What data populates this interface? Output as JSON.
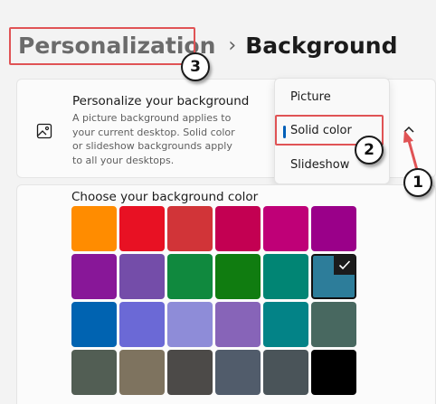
{
  "breadcrumb": {
    "parent": "Personalization",
    "separator": "›",
    "current": "Background"
  },
  "card": {
    "icon": "picture-icon",
    "title": "Personalize your background",
    "description": "A picture background applies to your current desktop. Solid color or slideshow backgrounds apply to all your desktops."
  },
  "dropdown": {
    "options": [
      "Picture",
      "Solid color",
      "Slideshow"
    ],
    "selected": "Solid color"
  },
  "expander_icon": "chevron-up-icon",
  "colors": {
    "label": "Choose your background color",
    "selected_index": 11,
    "swatches": [
      "#ff8c00",
      "#e81123",
      "#d13438",
      "#c30052",
      "#bf0077",
      "#9a0089",
      "#881798",
      "#744da9",
      "#10893e",
      "#107c10",
      "#018574",
      "#2d7d9a",
      "#0063b1",
      "#6b69d6",
      "#8e8cd8",
      "#8764b8",
      "#038387",
      "#486860",
      "#525e54",
      "#7e735f",
      "#4c4a48",
      "#515c6b",
      "#4a5459",
      "#000000"
    ]
  },
  "annotations": {
    "callouts": [
      "1",
      "2",
      "3"
    ],
    "highlight_color": "#e05355"
  }
}
